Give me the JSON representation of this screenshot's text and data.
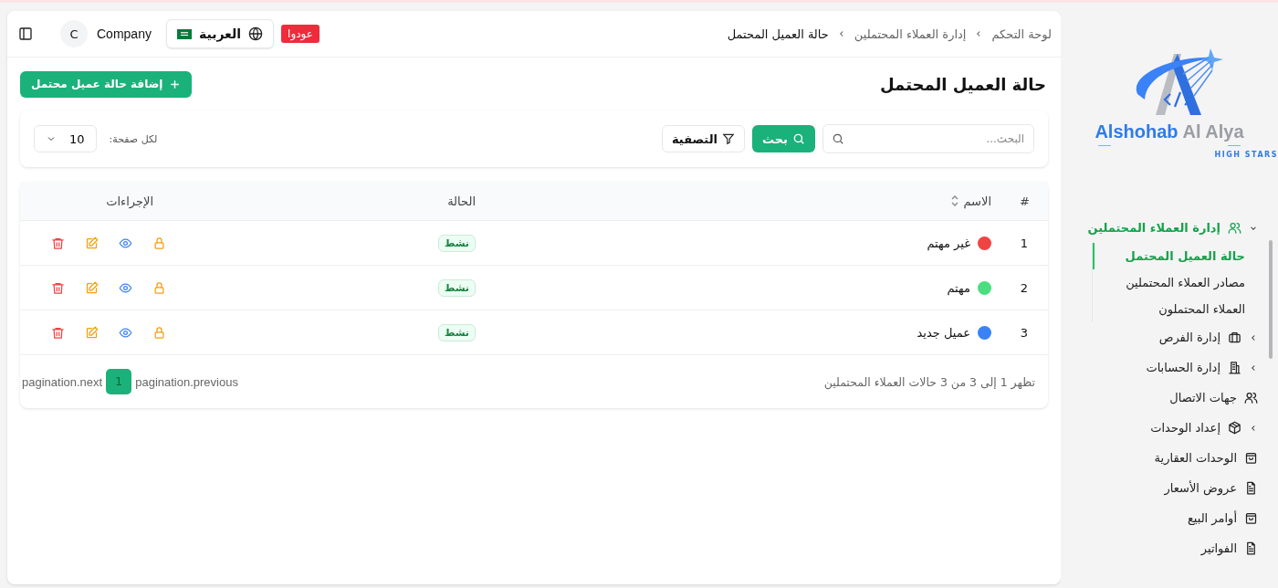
{
  "brand": {
    "name": "Alshohab",
    "name_suffix": "Al Alya",
    "tagline": "HIGH STARS"
  },
  "sidebar": {
    "items": [
      {
        "label": "إدارة العملاء المحتملين",
        "expanded": true,
        "selected": true,
        "children": [
          {
            "label": "حالة العميل المحتمل",
            "selected": true
          },
          {
            "label": "مصادر العملاء المحتملين",
            "selected": false
          },
          {
            "label": "العملاء المحتملون",
            "selected": false
          }
        ]
      },
      {
        "label": "إدارة الفرص",
        "expanded": false,
        "selected": false
      },
      {
        "label": "إدارة الحسابات",
        "expanded": false,
        "selected": false
      },
      {
        "label": "جهات الاتصال",
        "selected": false
      },
      {
        "label": "إعداد الوحدات",
        "expanded": false,
        "selected": false
      },
      {
        "label": "الوحدات العقارية",
        "selected": false
      },
      {
        "label": "عروض الأسعار",
        "selected": false
      },
      {
        "label": "أوامر البيع",
        "selected": false
      },
      {
        "label": "الفواتير",
        "selected": false
      }
    ]
  },
  "topbar": {
    "breadcrumb": [
      "لوحة التحكم",
      "إدارة العملاء المحتملين",
      "حالة العميل المحتمل"
    ],
    "badge": "عودوا",
    "language": "العربية",
    "company_initial": "C",
    "company": "Company"
  },
  "page": {
    "title": "حالة العميل المحتمل",
    "add_button": "إضافة حالة عميل محتمل"
  },
  "filters": {
    "search": {
      "placeholder": "البحث..."
    },
    "search_button": "بحث",
    "filter_button": "التصفية",
    "per_page_label": "لكل صفحة:",
    "per_page": "10"
  },
  "table": {
    "columns": [
      "#",
      "الاسم",
      "الحالة",
      "الإجراءات"
    ],
    "rows": [
      {
        "number": "1",
        "name": "غير مهتم",
        "color": "#ef4444",
        "status": "نشط"
      },
      {
        "number": "2",
        "name": "مهتم",
        "color": "#4ade80",
        "status": "نشط"
      },
      {
        "number": "3",
        "name": "عميل جديد",
        "color": "#3b82f6",
        "status": "نشط"
      }
    ],
    "summary": "تظهر 1 إلى 3 من 3 حالات العملاء المحتملين",
    "pagination": {
      "previous": "pagination.previous",
      "pages": [
        {
          "label": "1",
          "selected": true
        }
      ],
      "next": "pagination.next"
    }
  }
}
